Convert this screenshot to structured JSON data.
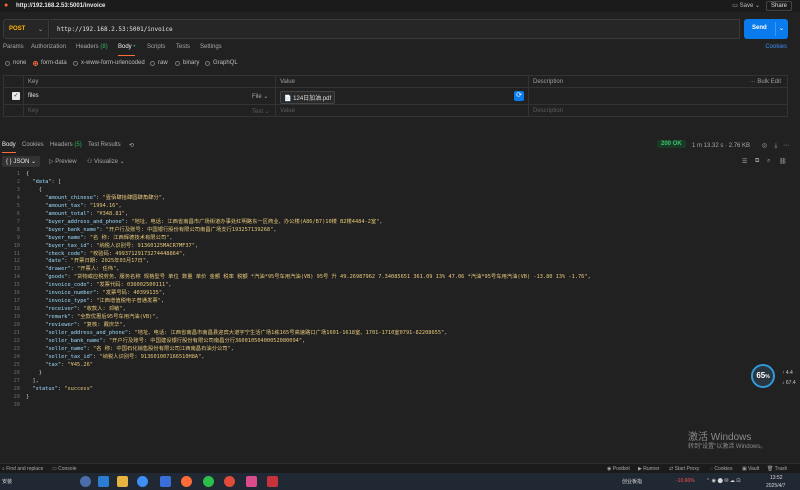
{
  "window": {
    "title": "http://192.168.2.53:5001/invoice",
    "save_label": "Save",
    "share_label": "Share"
  },
  "request": {
    "method": "POST",
    "url": "http://192.168.2.53:5001/invoice",
    "send_label": "Send",
    "tabs": {
      "params": "Params",
      "authorization": "Authorization",
      "headers": "Headers",
      "headers_count": "(8)",
      "body": "Body",
      "scripts": "Scripts",
      "tests": "Tests",
      "settings": "Settings"
    },
    "cookies_label": "Cookies",
    "body_types": [
      "none",
      "form-data",
      "x-www-form-urlencoded",
      "raw",
      "binary",
      "GraphQL"
    ],
    "body_type_selected": "form-data"
  },
  "kv": {
    "headers": {
      "key": "Key",
      "value": "Value",
      "description": "Description",
      "bulk_edit": "Bulk Edit"
    },
    "rows": [
      {
        "key": "files",
        "type": "File",
        "value": "124日加油.pdf",
        "checked": true
      }
    ],
    "placeholder": {
      "key": "Key",
      "type": "Text",
      "value": "Value",
      "description": "Description"
    }
  },
  "response": {
    "tabs": {
      "body": "Body",
      "cookies": "Cookies",
      "headers": "Headers",
      "headers_count": "(5)",
      "test_results": "Test Results"
    },
    "status": "200 OK",
    "time": "1 m 13.32 s",
    "size": "2.76 KB",
    "format": "JSON",
    "preview_label": "Preview",
    "visualize_label": "Visualize"
  },
  "code_lines": [
    "{",
    "  \"data\": [",
    "    {",
    "      \"amount_chinese\": \"壹佰肆拾肆圆肆角肆分\",",
    "      \"amount_tax\": \"1994.16\",",
    "      \"amount_total\": \"¥348.81\",",
    "      \"buyer_address_and_phone\": \"地址、电话: 江西省南昌市广场街道办事处红明路东一区商业、办公楼(A86/B7)10楼 B2楼4484-2室\",",
    "      \"buyer_bank_name\": \"开户行及账号: 中国银行股份有限公司南昌广场支行193257139268\",",
    "      \"buyer_name\": \"名 称: 江西辉德技术有限公司\",",
    "      \"buyer_tax_id\": \"纳税人识别号: 91360125MACR7MF37\",",
    "      \"check_code\": \"校验码: 49937129173274448864\",",
    "      \"date\": \"开票日期: 2025年03月17日\",",
    "      \"drawer\": \"开票人: 任伟\",",
    "      \"goods\": \"货物或应税劳务、服务名称 规格型号 单位 数量 单价 金额 税率 税额 *汽油*95号车用汽油(VB) 95号 升 49.26987962 7.34085651 361.09 13% 47.06 *汽油*95号车用汽油(VB) -13.80 13% -1.76\",",
    "      \"invoice_code\": \"发票代码: 036002500111\",",
    "      \"invoice_number\": \"发票号码: 40399135\",",
    "      \"invoice_type\": \"江西增值税电子普通发票\",",
    "      \"receiver\": \"收款人: 邓敏\",",
    "      \"remark\": \"全款优惠后95号车用汽油(VB)\",",
    "      \"reviewer\": \"复核: 戴庆华\",",
    "      \"seller_address_and_phone\": \"地址、电话: 江西省南昌市南昌县迎宾大道宇宁生活广场1栋165号高速路口广场1601-1618室、1701-1710室0791-82208655\",",
    "      \"seller_bank_name\": \"开户行及账号: 中国建设银行股份有限公司南昌分行36001050400052080094\",",
    "      \"seller_name\": \"名 称: 中国石化销售股份有限公司江西南昌石油分公司\",",
    "      \"seller_tax_id\": \"纳税人识别号: 913601007166510H8A\",",
    "      \"tax\": \"¥45.26\"",
    "    }",
    "  ],",
    "  \"status\": \"success\"",
    "}",
    ""
  ],
  "widgets": {
    "speed": "65",
    "speed_unit": "%",
    "net_up": "4.4",
    "net_down": "67.4"
  },
  "watermark": {
    "title": "激活 Windows",
    "subtitle": "转到\"设置\"以激活 Windows。"
  },
  "statusbar": {
    "find_replace": "Find and replace",
    "console": "Console",
    "postbot": "Postbot",
    "runner": "Runner",
    "start_proxy": "Start Proxy",
    "cookies": "Cookies",
    "vault": "Vault",
    "trash": "Trash"
  },
  "taskbar": {
    "weather": "安装",
    "stock_name": "创业板指",
    "stock_change": "-10.66%",
    "time": "13:52",
    "date": "2025/4/7"
  },
  "colors": {
    "accent": "#ff6c37",
    "send": "#097bed",
    "method": "#ffb400",
    "ok": "#3cc26d"
  }
}
